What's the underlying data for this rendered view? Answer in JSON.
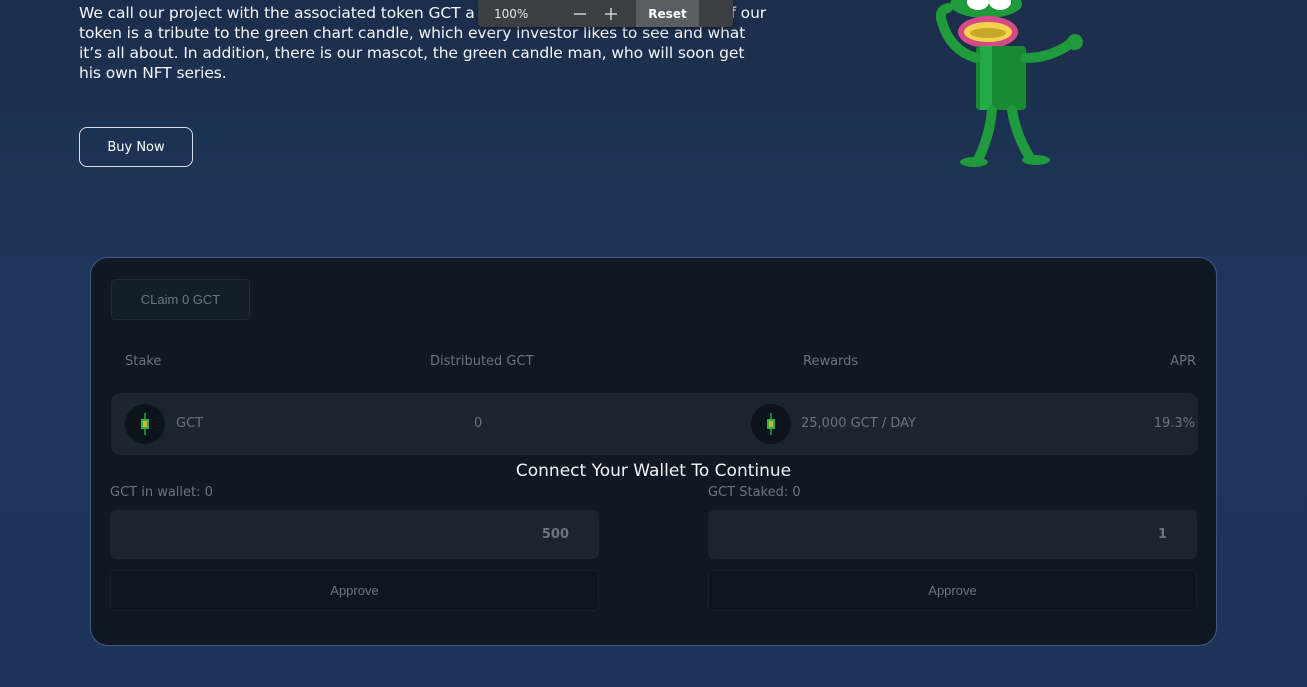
{
  "intro": {
    "text": "We call our project with the associated token GCT a smart token project. The name of our token is a tribute to the green chart candle, which every investor likes to see and what it’s all about. In addition, there is our mascot, the green candle man, who will soon get his own NFT series."
  },
  "buy_button": {
    "label": "Buy Now"
  },
  "zoom": {
    "value": "100%",
    "minus": "—",
    "plus": "+",
    "reset_label": "Reset"
  },
  "staking": {
    "claim_label": "CLaim 0 GCT",
    "headers": {
      "stake": "Stake",
      "distributed": "Distributed GCT",
      "rewards": "Rewards",
      "apr": "APR"
    },
    "row": {
      "stake_token": "GCT",
      "distributed_value": "0",
      "rewards_value": "25,000 GCT / DAY",
      "apr_value": "19.3%"
    },
    "connect_message": "Connect Your Wallet To Continue",
    "wallet": {
      "label": "GCT in wallet: 0",
      "input_value": "500",
      "approve_label": "Approve"
    },
    "staked": {
      "label": "GCT Staked: 0",
      "input_value": "1",
      "approve_label": "Approve"
    }
  },
  "colors": {
    "background": "#1d3558",
    "panel": "#0f1823",
    "panel_border": "#3d5a85",
    "mascot_green": "#1f9a3c"
  }
}
